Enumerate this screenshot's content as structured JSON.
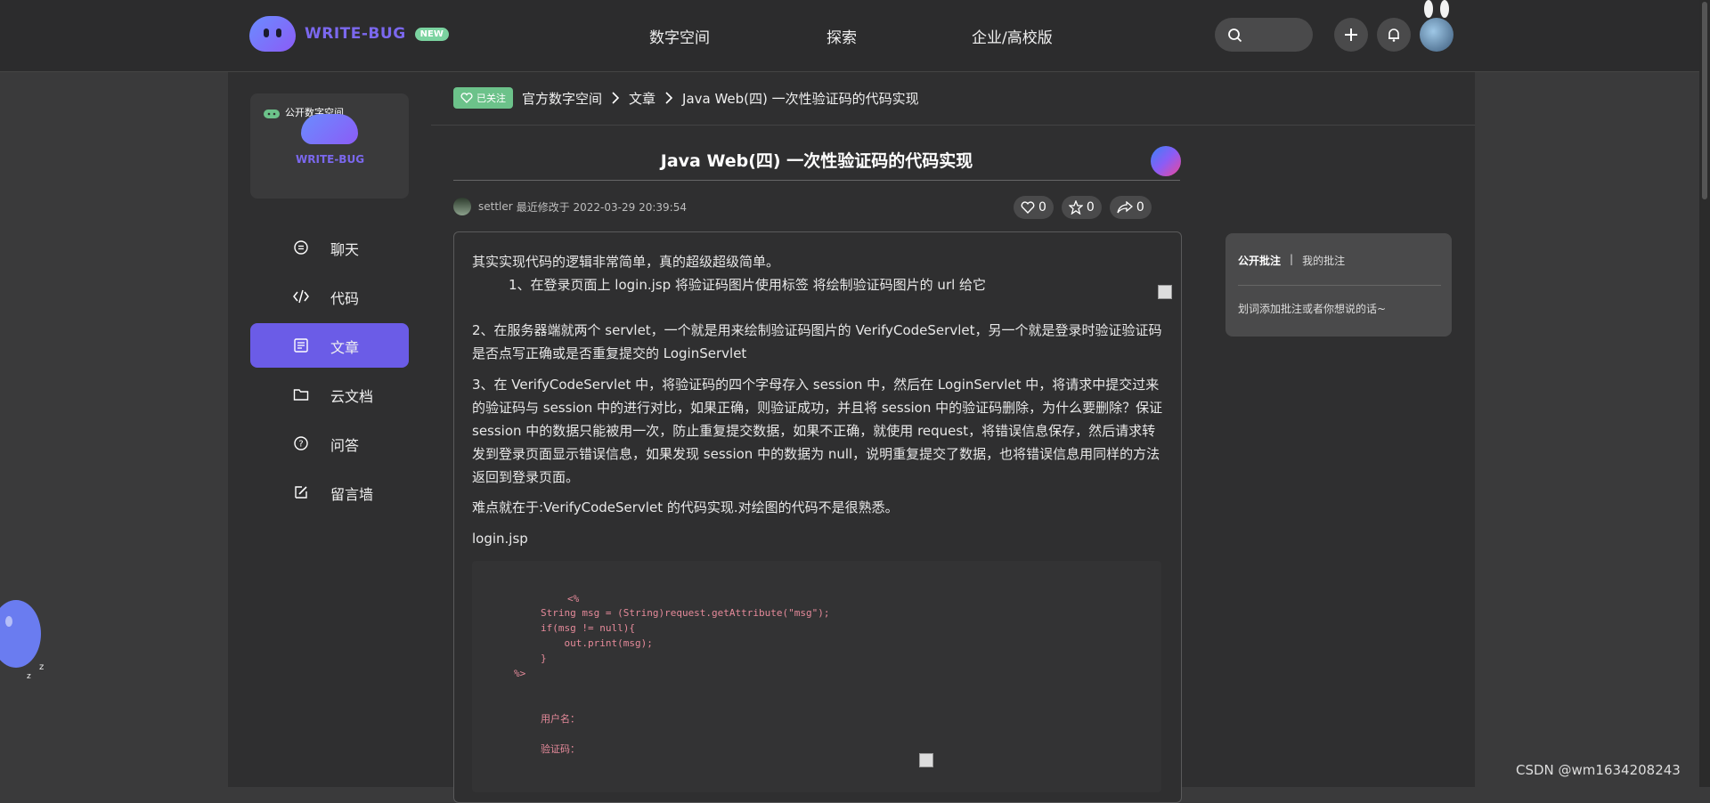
{
  "brand": {
    "name": "WRITE-BUG",
    "badge": "NEW"
  },
  "nav": {
    "items": [
      "数字空间",
      "探索",
      "企业/高校版"
    ]
  },
  "space_card": {
    "tag": "公开数字空间",
    "name": "WRITE-BUG"
  },
  "sidebar": {
    "items": [
      {
        "label": "聊天",
        "icon": "chat-icon"
      },
      {
        "label": "代码",
        "icon": "code-icon"
      },
      {
        "label": "文章",
        "icon": "article-icon",
        "active": true
      },
      {
        "label": "云文档",
        "icon": "folder-icon"
      },
      {
        "label": "问答",
        "icon": "question-icon"
      },
      {
        "label": "留言墙",
        "icon": "edit-icon"
      }
    ]
  },
  "breadcrumb": {
    "followed": "已关注",
    "items": [
      "官方数字空间",
      "文章",
      "Java Web(四) 一次性验证码的代码实现"
    ]
  },
  "article": {
    "title": "Java Web(四) 一次性验证码的代码实现",
    "author": "settler",
    "modified": "最近修改于 2022-03-29 20:39:54",
    "likes": "0",
    "stars": "0",
    "shares": "0",
    "paragraphs": [
      "其实实现代码的逻辑非常简单，真的超级超级简单。",
      "1、在登录页面上 login.jsp 将验证码图片使用标签    将绘制验证码图片的 url 给它",
      "2、在服务器端就两个 servlet，一个就是用来绘制验证码图片的 VerifyCodeServlet，另一个就是登录时验证验证码是否点写正确或是否重复提交的 LoginServlet",
      "3、在 VerifyCodeServlet 中，将验证码的四个字母存入 session 中，然后在 LoginServlet 中，将请求中提交过来的验证码与 session 中的进行对比，如果正确，则验证成功，并且将 session 中的验证码删除，为什么要删除？保证 session 中的数据只能被用一次，防止重复提交数据，如果不正确，就使用 request，将错误信息保存，然后请求转发到登录页面显示错误信息，如果发现 session 中的数据为 null，说明重复提交了数据，也将错误信息用同样的方法返回到登录页面。",
      "难点就在于:VerifyCodeServlet 的代码实现.对绘图的代码不是很熟悉。",
      "login.jsp"
    ],
    "code_lines": [
      "<%",
      "String msg = (String)request.getAttribute(\"msg\");",
      "if(msg != null){",
      "    out.print(msg);",
      "}",
      "%>",
      "用户名：",
      "验证码："
    ]
  },
  "annotations": {
    "tab_public": "公开批注",
    "divider": "|",
    "tab_mine": "我的批注",
    "hint": "划词添加批注或者你想说的话~"
  },
  "watermark": "CSDN @wm1634208243",
  "colors": {
    "accent": "#6b5ce7",
    "followed": "#6cc28a",
    "code": "#e58a9a"
  }
}
